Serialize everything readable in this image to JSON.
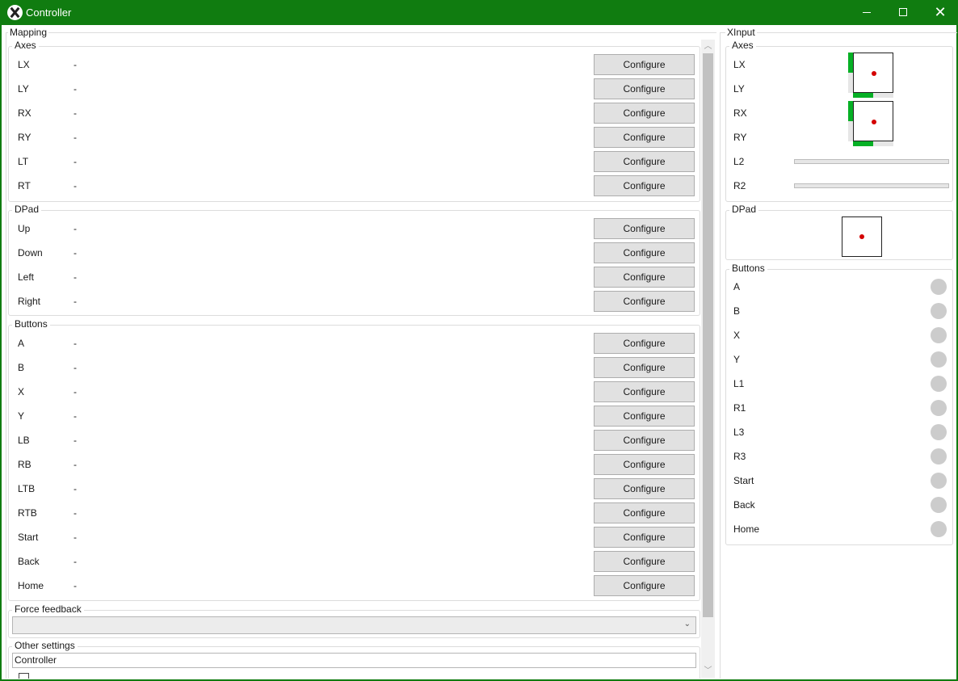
{
  "window": {
    "title": "Controller"
  },
  "mapping": {
    "title": "Mapping",
    "button_label": "Configure",
    "axes": {
      "title": "Axes",
      "rows": [
        {
          "label": "LX",
          "value": "-"
        },
        {
          "label": "LY",
          "value": "-"
        },
        {
          "label": "RX",
          "value": "-"
        },
        {
          "label": "RY",
          "value": "-"
        },
        {
          "label": "LT",
          "value": "-"
        },
        {
          "label": "RT",
          "value": "-"
        }
      ]
    },
    "dpad": {
      "title": "DPad",
      "rows": [
        {
          "label": "Up",
          "value": "-"
        },
        {
          "label": "Down",
          "value": "-"
        },
        {
          "label": "Left",
          "value": "-"
        },
        {
          "label": "Right",
          "value": "-"
        }
      ]
    },
    "buttons": {
      "title": "Buttons",
      "rows": [
        {
          "label": "A",
          "value": "-"
        },
        {
          "label": "B",
          "value": "-"
        },
        {
          "label": "X",
          "value": "-"
        },
        {
          "label": "Y",
          "value": "-"
        },
        {
          "label": "LB",
          "value": "-"
        },
        {
          "label": "RB",
          "value": "-"
        },
        {
          "label": "LTB",
          "value": "-"
        },
        {
          "label": "RTB",
          "value": "-"
        },
        {
          "label": "Start",
          "value": "-"
        },
        {
          "label": "Back",
          "value": "-"
        },
        {
          "label": "Home",
          "value": "-"
        }
      ]
    },
    "force_feedback": {
      "title": "Force feedback",
      "selected": ""
    },
    "other_settings": {
      "title": "Other settings",
      "name_value": "Controller"
    }
  },
  "xinput": {
    "title": "XInput",
    "axes": {
      "title": "Axes",
      "labels": [
        "LX",
        "LY",
        "RX",
        "RY",
        "L2",
        "R2"
      ],
      "left_stick": {
        "x_level": 0.5,
        "y_level": 0.5
      },
      "right_stick": {
        "x_level": 0.5,
        "y_level": 0.5
      },
      "l2_level": 0,
      "r2_level": 0
    },
    "dpad": {
      "title": "DPad"
    },
    "buttons": {
      "title": "Buttons",
      "labels": [
        "A",
        "B",
        "X",
        "Y",
        "L1",
        "R1",
        "L3",
        "R3",
        "Start",
        "Back",
        "Home"
      ]
    }
  },
  "colors": {
    "titlebar": "#107c10",
    "indicator_green": "#06b025",
    "stick_dot": "#d40000",
    "led_off": "#cccccc"
  }
}
